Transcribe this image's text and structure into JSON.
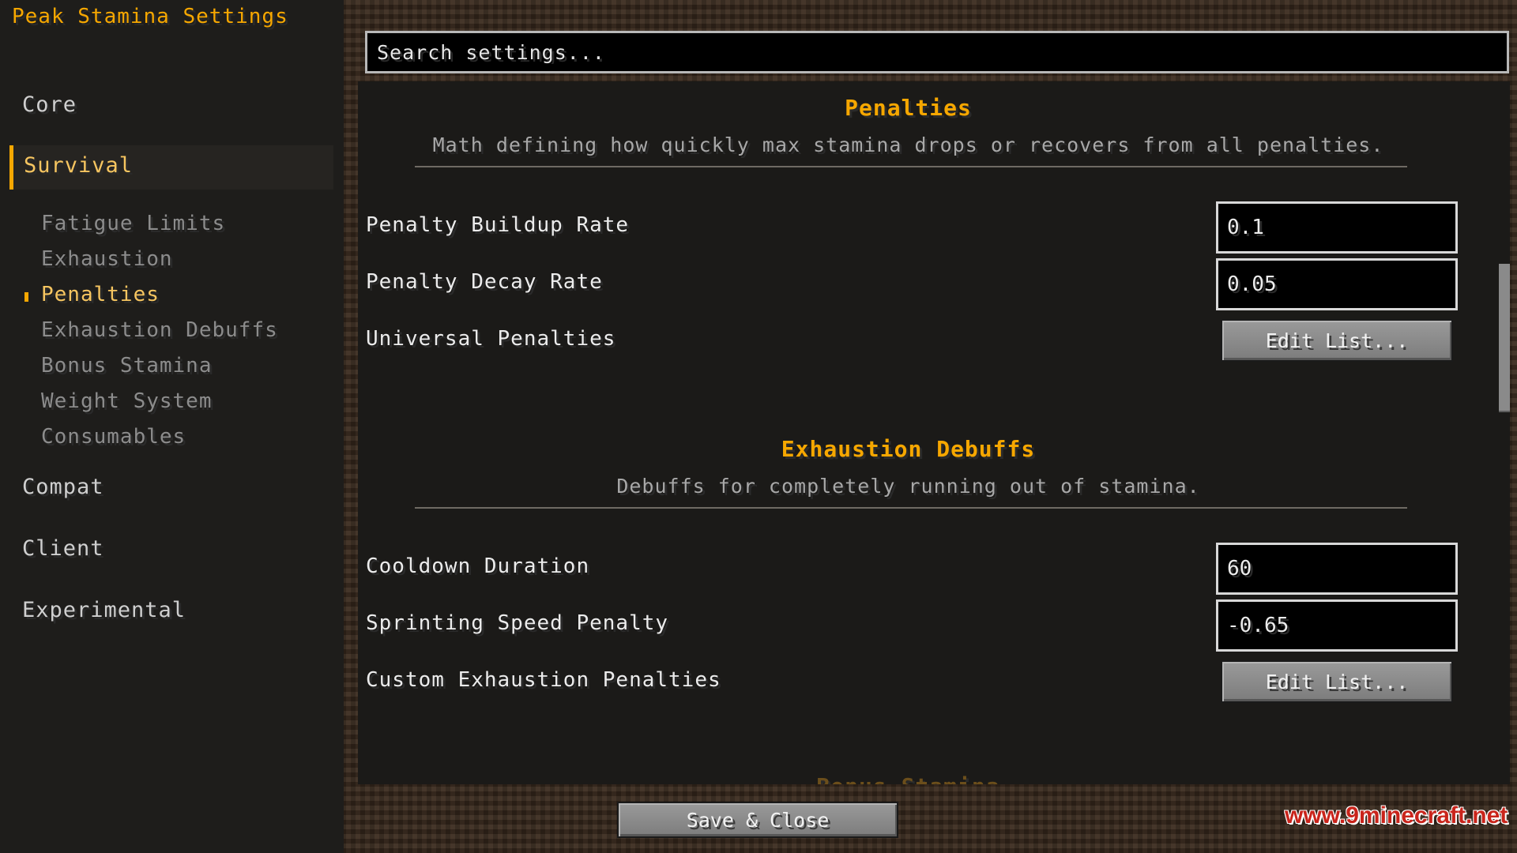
{
  "app": {
    "title": "Peak Stamina Settings"
  },
  "sidebar": {
    "categories": [
      {
        "label": "Core"
      },
      {
        "label": "Survival"
      },
      {
        "label": "Compat"
      },
      {
        "label": "Client"
      },
      {
        "label": "Experimental"
      }
    ],
    "active_category": "Survival",
    "subitems": [
      {
        "label": "Fatigue Limits"
      },
      {
        "label": "Exhaustion"
      },
      {
        "label": "Penalties"
      },
      {
        "label": "Exhaustion Debuffs"
      },
      {
        "label": "Bonus Stamina"
      },
      {
        "label": "Weight System"
      },
      {
        "label": "Consumables"
      }
    ],
    "current_subitem": "Penalties"
  },
  "search": {
    "placeholder": "Search settings..."
  },
  "sections": [
    {
      "title": "Penalties",
      "description": "Math defining how quickly max stamina drops or recovers from all penalties.",
      "settings": [
        {
          "label": "Penalty Buildup Rate",
          "type": "number",
          "value": "0.1"
        },
        {
          "label": "Penalty Decay Rate",
          "type": "number",
          "value": "0.05"
        },
        {
          "label": "Universal Penalties",
          "type": "list",
          "button": "Edit List..."
        }
      ]
    },
    {
      "title": "Exhaustion Debuffs",
      "description": "Debuffs for completely running out of stamina.",
      "settings": [
        {
          "label": "Cooldown Duration",
          "type": "number",
          "value": "60"
        },
        {
          "label": "Sprinting Speed Penalty",
          "type": "number",
          "value": "-0.65"
        },
        {
          "label": "Custom Exhaustion Penalties",
          "type": "list",
          "button": "Edit List..."
        }
      ]
    },
    {
      "title": "Bonus Stamina"
    }
  ],
  "footer": {
    "save_label": "Save & Close"
  },
  "watermark": "www.9minecraft.net",
  "colors": {
    "accent": "#f6a700",
    "sidebar_bg": "#1e1d1b",
    "panel_bg": "#1b1a18",
    "watermark": "#c9241b"
  }
}
